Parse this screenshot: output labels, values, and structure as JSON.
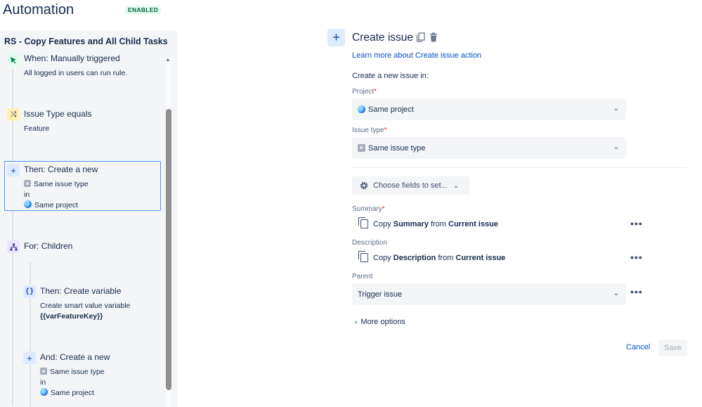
{
  "header": {
    "title": "Automation",
    "status_badge": "ENABLED"
  },
  "rule": {
    "name": "RS - Copy Features and All Child Tasks",
    "trigger": {
      "title": "When: Manually triggered",
      "subtitle": "All logged in users can run rule."
    },
    "condition": {
      "title": "Issue Type equals",
      "subtitle": "Feature"
    },
    "action1": {
      "title": "Then: Create a new",
      "line1": "Same issue type",
      "line2": "in",
      "line3": "Same project"
    },
    "branch": {
      "title": "For: Children"
    },
    "action2": {
      "title": "Then: Create variable",
      "line1": "Create smart value variable",
      "line2": "{{varFeatureKey}}"
    },
    "action3": {
      "title": "And: Create a new",
      "line1": "Same issue type",
      "line2": "in",
      "line3": "Same project"
    }
  },
  "editor": {
    "title": "Create issue",
    "learn_more": "Learn more about Create issue action",
    "create_in_label": "Create a new issue in:",
    "project_label": "Project",
    "project_value": "Same project",
    "issue_type_label": "Issue type",
    "issue_type_value": "Same issue type",
    "choose_fields": "Choose fields to set...",
    "summary_label": "Summary",
    "summary_copy": {
      "pre": "Copy",
      "field": "Summary",
      "mid": "from",
      "source": "Current issue"
    },
    "description_label": "Description",
    "description_copy": {
      "pre": "Copy",
      "field": "Description",
      "mid": "from",
      "source": "Current issue"
    },
    "parent_label": "Parent",
    "parent_value": "Trigger issue",
    "more_options": "More options",
    "cancel": "Cancel",
    "save": "Save",
    "required_mark": "*"
  },
  "icons": {
    "add": "plus-icon",
    "copy": "copy-icon",
    "delete": "trash-icon",
    "trigger": "cursor-icon",
    "condition": "shuffle-icon",
    "branch": "hierarchy-icon",
    "variable": "braces-icon",
    "settings": "gear-icon",
    "dropdown": "chevron-down-icon",
    "more": "more-icon"
  },
  "colors": {
    "accent": "#0052cc",
    "selected_border": "#4c9aff",
    "badge_text": "#006644",
    "badge_bg": "#e3fcef"
  }
}
